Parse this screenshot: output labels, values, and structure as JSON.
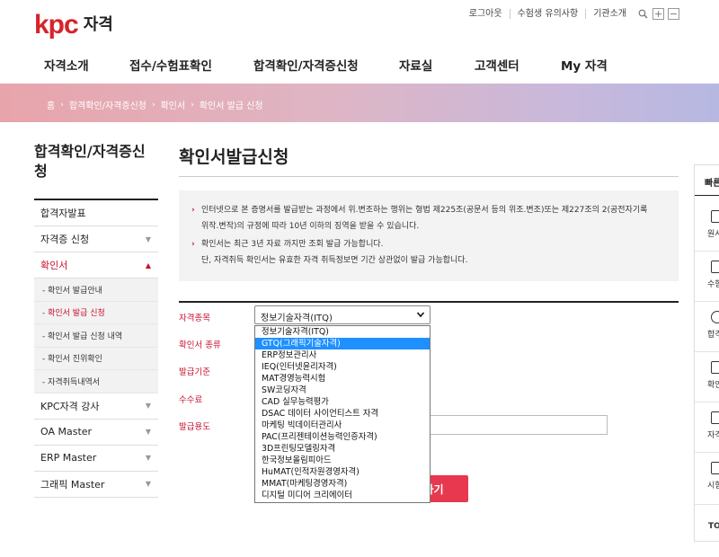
{
  "header": {
    "logo_text": "kpc",
    "logo_sub": "자격",
    "util_links": [
      "로그아웃",
      "수험생 유의사항",
      "기관소개"
    ],
    "nav": [
      "자격소개",
      "접수/수험표확인",
      "합격확인/자격증신청",
      "자료실",
      "고객센터",
      "My 자격"
    ]
  },
  "breadcrumb": [
    "홈",
    "합격확인/자격증신청",
    "확인서",
    "확인서 발급 신청"
  ],
  "sidebar": {
    "title": "합격확인/자격증신청",
    "items": [
      {
        "label": "합격자발표"
      },
      {
        "label": "자격증 신청"
      },
      {
        "label": "확인서"
      }
    ],
    "sub_items": [
      "- 확인서 발급안내",
      "- 확인서 발급 신청",
      "- 확인서 발급 신청 내역",
      "- 확인서 진위확인",
      "- 자격취득내역서"
    ],
    "items_after": [
      "KPC자격 강사",
      "OA Master",
      "ERP Master",
      "그래픽 Master"
    ]
  },
  "main": {
    "title": "확인서발급신청",
    "notice": [
      "인터넷으로 본 증명서를 발급받는 과정에서 위.변조하는 행위는 형법 제225조(공문서 등의 위조.변조)또는 제227조의 2(공전자기록",
      "위작.변작)의 규정에 따라 10년 이하의 징역을 받을 수 있습니다.",
      "확인서는 최근 3년 자료 까지만 조회 발급 가능합니다.",
      "단, 자격취득 확인서는 유효한 자격 취득정보면 기간 상관없이 발급 가능합니다."
    ],
    "notice_marker": "›",
    "form": {
      "labels": [
        "자격종목",
        "확인서 종류",
        "발급기준",
        "수수료",
        "발급용도"
      ],
      "select_value": "정보기술자격(ITQ)",
      "options": [
        "정보기술자격(ITQ)",
        "GTQ(그래픽기술자격)",
        "ERP정보관리사",
        "IEQ(인터넷윤리자격)",
        "MAT경영능력시험",
        "SW코딩자격",
        "CAD 실무능력평가",
        "DSAC 데이터 사이언티스트 자격",
        "마케팅 빅데이터관리사",
        "PAC(프리젠테이션능력인증자격)",
        "3D프린팅모델링자격",
        "한국정보올림피아드",
        "HuMAT(인적자원경영자격)",
        "MMAT(마케팅경영자격)",
        "디지털 미디어 크리에이터"
      ],
      "highlighted_index": 1,
      "apply_label_visible": "하기"
    }
  },
  "quick": {
    "title": "빠른",
    "labels": [
      "원서",
      "수험",
      "합격",
      "확인",
      "자격",
      "시험"
    ],
    "bottom": "TO"
  }
}
